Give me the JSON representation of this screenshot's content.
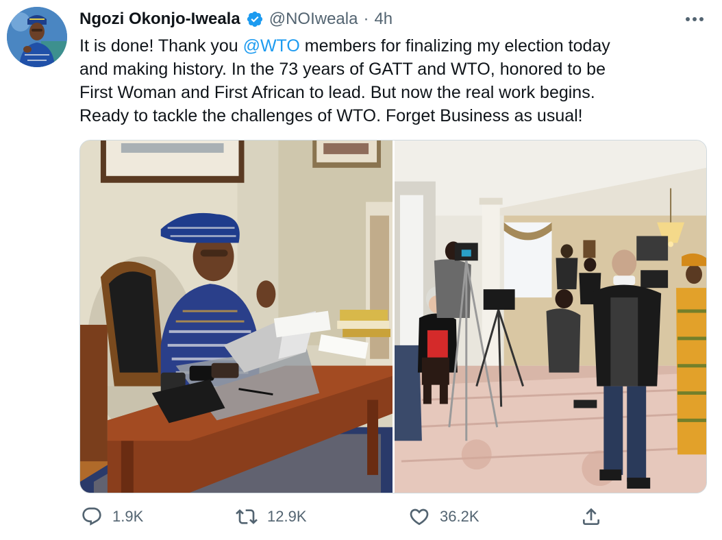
{
  "author": {
    "display_name": "Ngozi Okonjo-Iweala",
    "handle": "@NOIweala",
    "separator": "·",
    "time": "4h",
    "verified": true
  },
  "tweet": {
    "line1_before": "It is done! Thank you ",
    "line1_mention": "@WTO",
    "line1_after": " members for finalizing my election today",
    "line2": "and making history. In the 73 years of GATT and WTO, honored to be",
    "line3": "First Woman and First African to lead. But now the real work begins.",
    "line4": "Ready to tackle the challenges of WTO. Forget Business as usual!"
  },
  "actions": {
    "reply_count": "1.9K",
    "retweet_count": "12.9K",
    "like_count": "36.2K"
  },
  "icons": {
    "avatar": "profile-photo",
    "verified": "verified-badge-icon",
    "more": "more-dots-icon",
    "reply": "reply-icon",
    "retweet": "retweet-icon",
    "like": "heart-icon",
    "share": "share-icon"
  },
  "colors": {
    "accent": "#1d9bf0",
    "text_primary": "#0f1419",
    "text_secondary": "#536471",
    "border": "#cfd9de"
  }
}
